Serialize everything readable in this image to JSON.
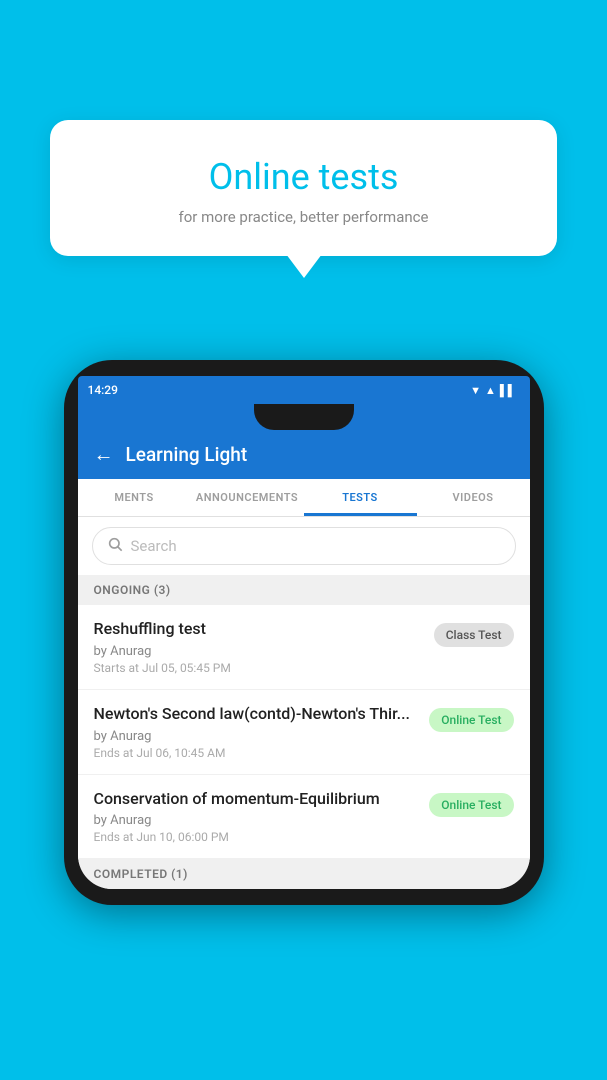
{
  "background_color": "#00BFEA",
  "bubble": {
    "title": "Online tests",
    "subtitle": "for more practice, better performance"
  },
  "status_bar": {
    "time": "14:29",
    "icons": [
      "▼",
      "▲",
      "▌▌"
    ]
  },
  "app_bar": {
    "title": "Learning Light",
    "back_label": "←"
  },
  "tabs": [
    {
      "label": "MENTS",
      "active": false
    },
    {
      "label": "ANNOUNCEMENTS",
      "active": false
    },
    {
      "label": "TESTS",
      "active": true
    },
    {
      "label": "VIDEOS",
      "active": false
    }
  ],
  "search": {
    "placeholder": "Search"
  },
  "sections": [
    {
      "header": "ONGOING (3)",
      "items": [
        {
          "name": "Reshuffling test",
          "by": "by Anurag",
          "date_label": "Starts at",
          "date": "Jul 05, 05:45 PM",
          "badge": "Class Test",
          "badge_type": "class"
        },
        {
          "name": "Newton's Second law(contd)-Newton's Thir...",
          "by": "by Anurag",
          "date_label": "Ends at",
          "date": "Jul 06, 10:45 AM",
          "badge": "Online Test",
          "badge_type": "online"
        },
        {
          "name": "Conservation of momentum-Equilibrium",
          "by": "by Anurag",
          "date_label": "Ends at",
          "date": "Jun 10, 06:00 PM",
          "badge": "Online Test",
          "badge_type": "online"
        }
      ]
    }
  ],
  "completed_section": {
    "header": "COMPLETED (1)"
  }
}
